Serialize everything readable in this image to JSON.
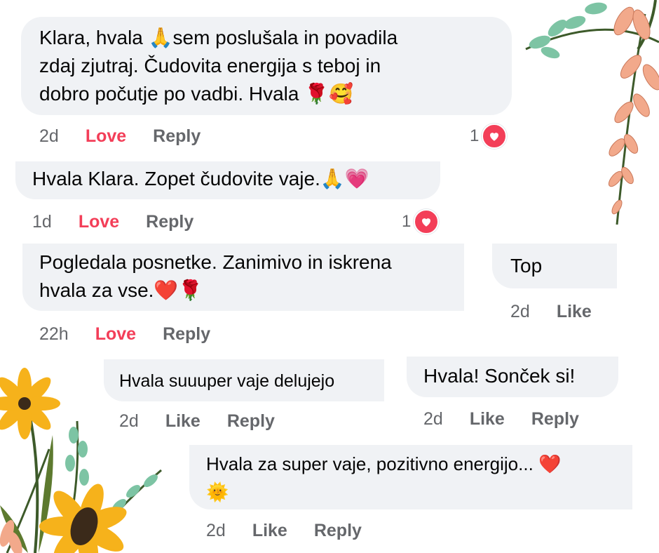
{
  "comments": [
    {
      "id": "c1",
      "text_lines": [
        "Klara, hvala 🙏sem poslušala in povadila",
        "zdaj zjutraj. Čudovita energija s teboj in",
        "dobro počutje po vadbi. Hvala 🌹🥰"
      ],
      "time": "2d",
      "reaction_label": "Love",
      "reply_label": "Reply",
      "reaction_count": "1"
    },
    {
      "id": "c2",
      "text_lines": [
        "Hvala Klara. Zopet čudovite vaje.🙏💗"
      ],
      "time": "1d",
      "reaction_label": "Love",
      "reply_label": "Reply",
      "reaction_count": "1"
    },
    {
      "id": "c3",
      "text_lines": [
        "Pogledala posnetke. Zanimivo in iskrena",
        "hvala za vse.❤️🌹"
      ],
      "time": "22h",
      "reaction_label": "Love",
      "reply_label": "Reply"
    },
    {
      "id": "c4",
      "text_lines": [
        "Top"
      ],
      "time": "2d",
      "reaction_label": "Like"
    },
    {
      "id": "c5",
      "text_lines": [
        "Hvala suuuper vaje delujejo"
      ],
      "time": "2d",
      "reaction_label": "Like",
      "reply_label": "Reply"
    },
    {
      "id": "c6",
      "text_lines": [
        "Hvala! Sonček si!"
      ],
      "time": "2d",
      "reaction_label": "Like",
      "reply_label": "Reply"
    },
    {
      "id": "c7",
      "text_lines": [
        "Hvala za super vaje, pozitivno energijo... ❤️",
        "🌞"
      ],
      "time": "2d",
      "reaction_label": "Like",
      "reply_label": "Reply"
    }
  ],
  "colors": {
    "bubble": "#f0f2f5",
    "love": "#f33e58",
    "meta": "#65676b",
    "text": "#050505"
  },
  "icons": {
    "reaction_badge": "heart-icon"
  }
}
